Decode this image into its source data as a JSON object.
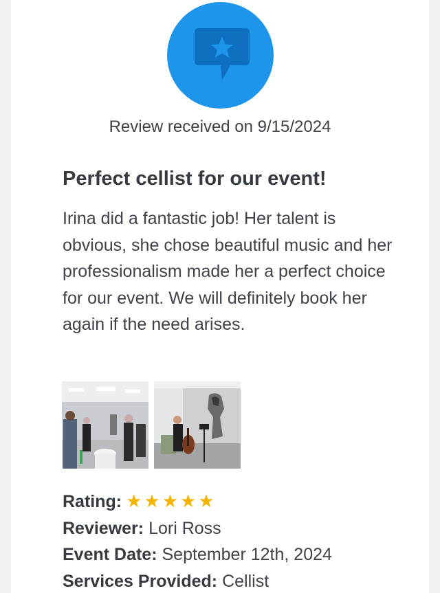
{
  "badge": {
    "icon": "review-star-bubble-icon",
    "color": "#1c95ea"
  },
  "received_text": "Review received on 9/15/2024",
  "review": {
    "title": "Perfect cellist for our event!",
    "body": "Irina did a fantastic job! Her talent is obvious, she chose beautiful music and her professionalism made her a perfect choice for our event. We will definitely book her again if the need arises."
  },
  "photos": [
    {
      "icon": "event-guests-photo"
    },
    {
      "icon": "cellist-performing-photo"
    }
  ],
  "details": {
    "rating_label": "Rating:",
    "rating_value": 5,
    "rating_max": 5,
    "rating_stars": "★★★★★",
    "star_color": "#f5b400",
    "reviewer_label": "Reviewer:",
    "reviewer_value": "Lori Ross",
    "event_date_label": "Event Date:",
    "event_date_value": "September 12th, 2024",
    "services_label": "Services Provided:",
    "services_value": "Cellist"
  }
}
